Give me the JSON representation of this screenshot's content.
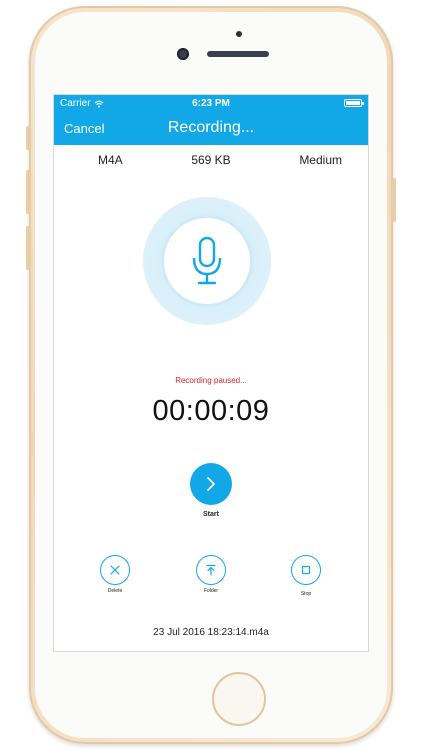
{
  "status_bar": {
    "carrier": "Carrier",
    "time": "6:23 PM"
  },
  "nav": {
    "cancel_label": "Cancel",
    "title": "Recording..."
  },
  "info": {
    "format": "M4A",
    "size": "569 KB",
    "quality": "Medium"
  },
  "recorder": {
    "status": "Recording paused...",
    "elapsed": "00:00:09",
    "start_label": "Start"
  },
  "actions": {
    "delete_label": "Delete",
    "folder_label": "Folder",
    "stop_label": "Stop"
  },
  "file": {
    "name": "23 Jul 2016 18:23:14.m4a"
  },
  "colors": {
    "accent": "#12a8e8",
    "status_red": "#d6262e"
  },
  "icons": {
    "mic": "microphone-icon",
    "start": "chevron-right-icon",
    "delete": "close-icon",
    "folder": "upload-icon",
    "stop": "stop-square-icon"
  }
}
